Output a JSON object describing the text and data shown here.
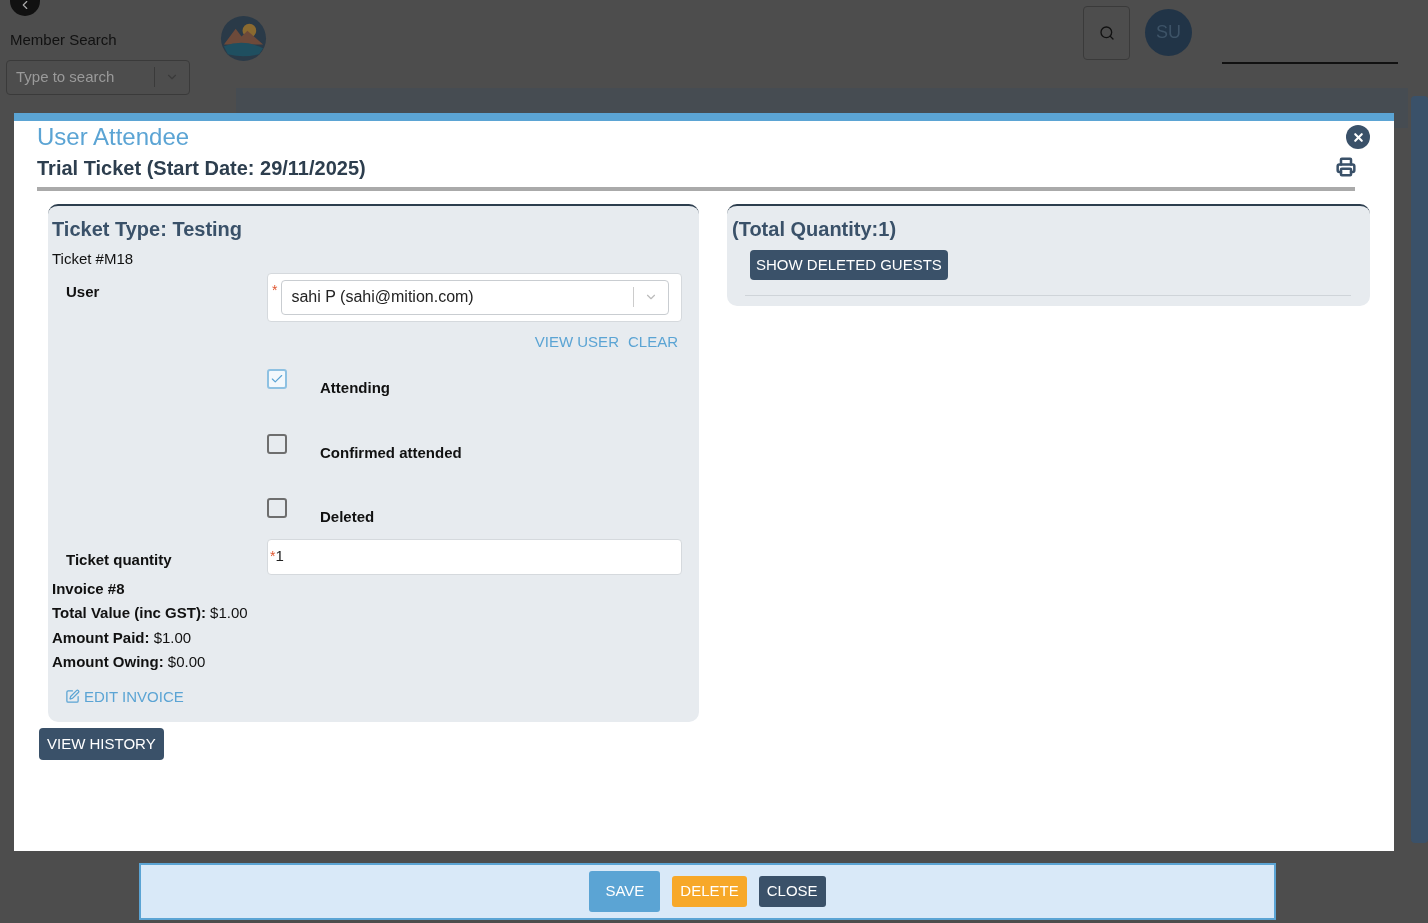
{
  "background": {
    "sidebar": {
      "search_label": "Member Search",
      "search_placeholder": "Type to search"
    },
    "avatar": "SU"
  },
  "modal": {
    "title": "User Attendee",
    "subtitle": "Trial Ticket (Start Date: 29/11/2025)",
    "ticket": {
      "type_heading": "Ticket Type: Testing",
      "number": "Ticket #M18",
      "user_label": "User",
      "required_marker": "*",
      "user_value": "sahi P (sahi@mition.com)",
      "links": [
        "VIEW USER",
        "CLEAR"
      ],
      "checkboxes": [
        {
          "label": "Attending",
          "checked": true
        },
        {
          "label": "Confirmed attended",
          "checked": false
        },
        {
          "label": "Deleted",
          "checked": false
        }
      ],
      "quantity_label": "Ticket quantity",
      "quantity_value": "1",
      "invoice_title": "Invoice #8",
      "invoice_lines": [
        {
          "label": "Total Value (inc GST):",
          "value": "$1.00"
        },
        {
          "label": "Amount Paid:",
          "value": "$1.00"
        },
        {
          "label": "Amount Owing:",
          "value": "$0.00"
        }
      ],
      "edit_invoice": "EDIT INVOICE"
    },
    "view_history": "VIEW HISTORY",
    "guests": {
      "heading": "(Total Quantity:1)",
      "button": "SHOW DELETED GUESTS"
    }
  },
  "footer_buttons": [
    {
      "label": "SAVE",
      "kind": "primary"
    },
    {
      "label": "DELETE",
      "kind": "warning"
    },
    {
      "label": "CLOSE",
      "kind": "dark"
    }
  ]
}
